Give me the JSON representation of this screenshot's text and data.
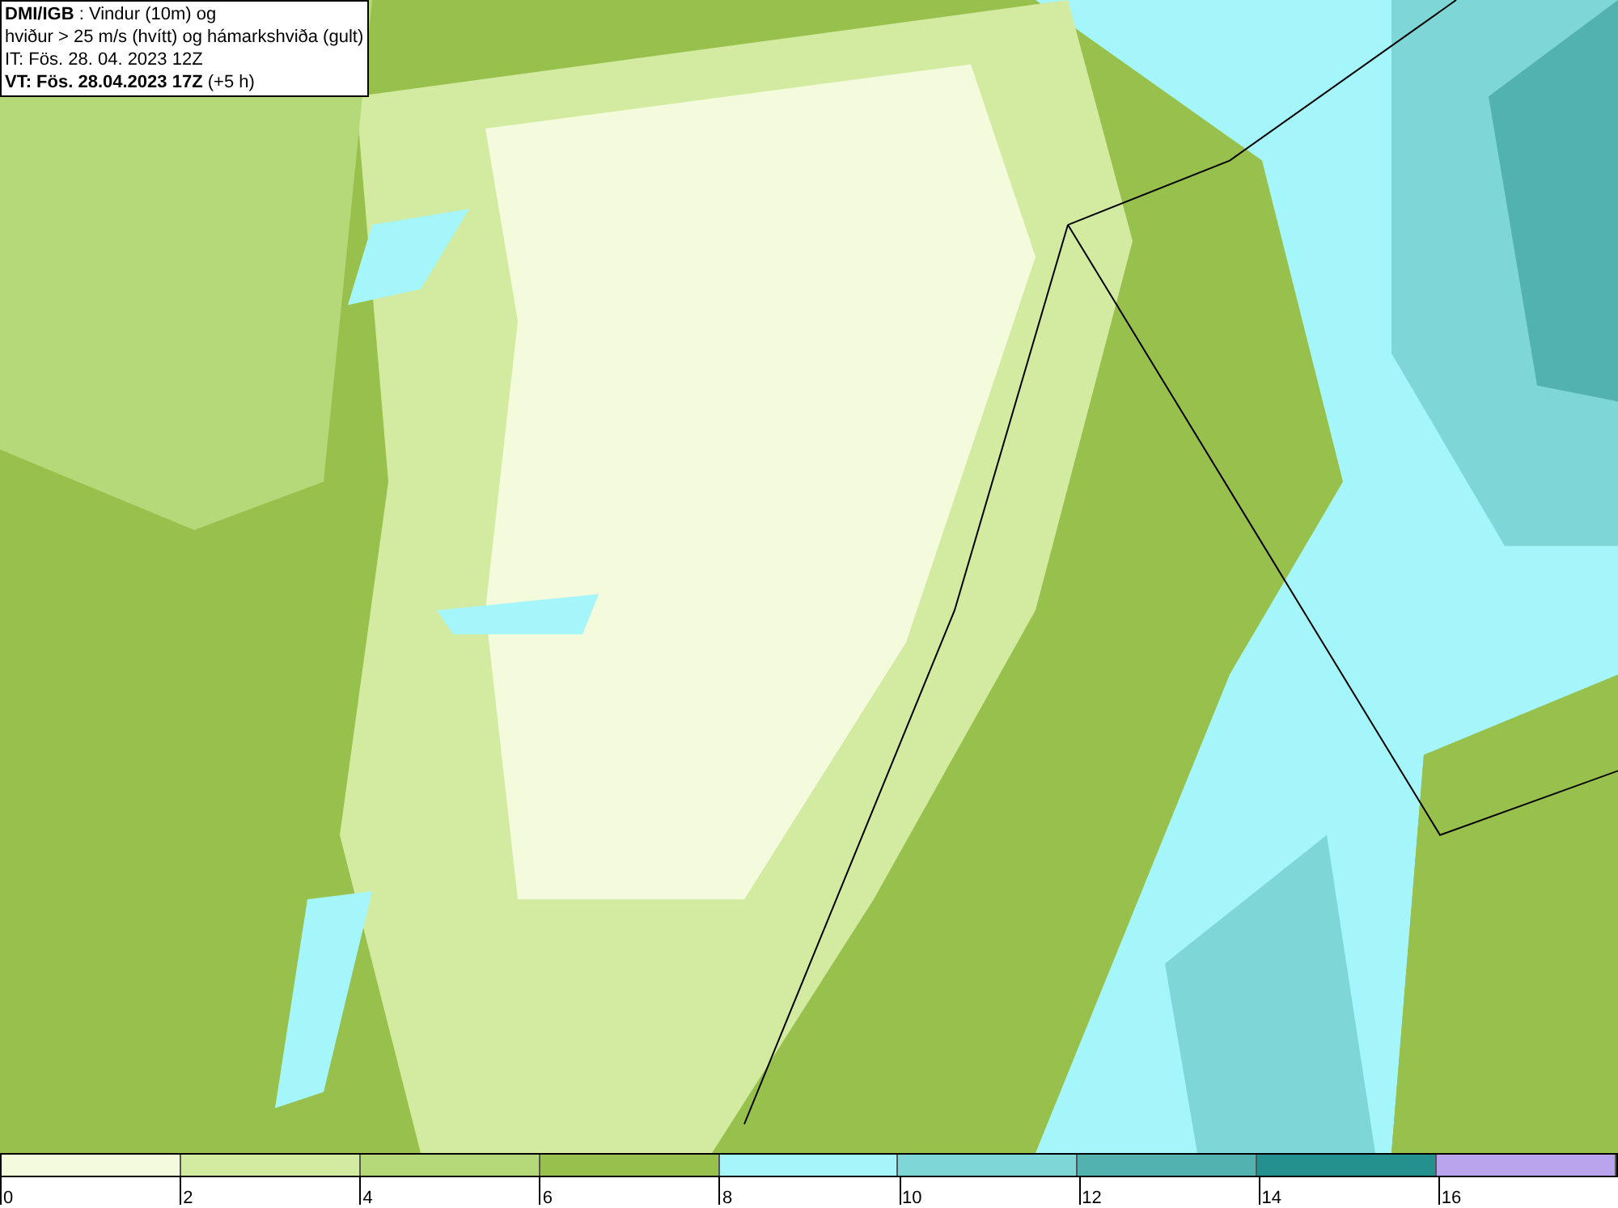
{
  "header": {
    "lines": [
      {
        "text": "**DMI/IGB** : Vindur (10m) og"
      },
      {
        "text": "hviður > 25 m/s (hvítt) og hámarkshviða (gult)"
      },
      {
        "text": "IT: Fös. 28. 04. 2023 12Z"
      },
      {
        "text": "**VT: Fös. 28.04.2023 17Z** (+5 h)"
      }
    ]
  },
  "colorbar": [
    {
      "color": "#f4fbdc",
      "label": "0"
    },
    {
      "color": "#d3eba0",
      "label": "2"
    },
    {
      "color": "#b5d878",
      "label": "4"
    },
    {
      "color": "#98c04c",
      "label": "6"
    },
    {
      "color": "#a4f6fa",
      "label": "8"
    },
    {
      "color": "#7fd6d6",
      "label": "10"
    },
    {
      "color": "#52b2b0",
      "label": "12"
    },
    {
      "color": "#25918e",
      "label": "14"
    },
    {
      "color": "#b9a4ee",
      "label": "16"
    }
  ]
}
